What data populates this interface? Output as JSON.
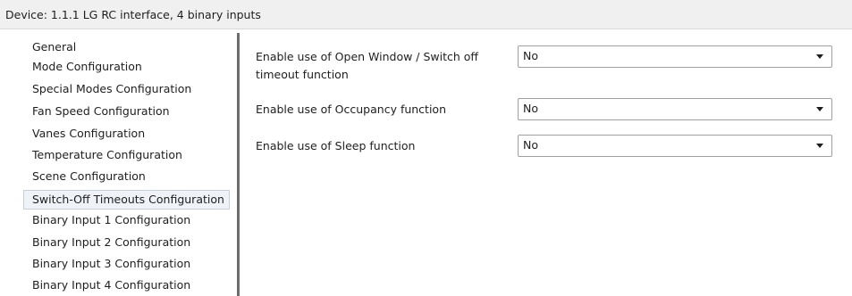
{
  "header": {
    "title": "Device: 1.1.1  LG RC interface, 4 binary inputs"
  },
  "sidebar": {
    "items": [
      {
        "label": "General"
      },
      {
        "label": "Mode Configuration"
      },
      {
        "label": "Special Modes Configuration"
      },
      {
        "label": "Fan Speed Configuration"
      },
      {
        "label": "Vanes Configuration"
      },
      {
        "label": "Temperature Configuration"
      },
      {
        "label": "Scene Configuration"
      },
      {
        "label": "Switch-Off Timeouts Configuration",
        "selected": true
      },
      {
        "label": "Binary Input 1 Configuration"
      },
      {
        "label": "Binary Input 2 Configuration"
      },
      {
        "label": "Binary Input 3 Configuration"
      },
      {
        "label": "Binary Input 4 Configuration"
      }
    ]
  },
  "main": {
    "params": [
      {
        "label": "Enable use of Open Window / Switch off timeout function",
        "value": "No",
        "icon": "chevron-down-icon"
      },
      {
        "label": "Enable use of Occupancy function",
        "value": "No",
        "icon": "chevron-down-icon"
      },
      {
        "label": "Enable use of Sleep function",
        "value": "No",
        "icon": "chevron-down-icon"
      }
    ]
  },
  "colors": {
    "selected_item_background": "#eff3f8",
    "selected_item_border": "#c4d0de",
    "divider": "#6d6d6d",
    "title_bar_background": "#f0f0f0"
  }
}
